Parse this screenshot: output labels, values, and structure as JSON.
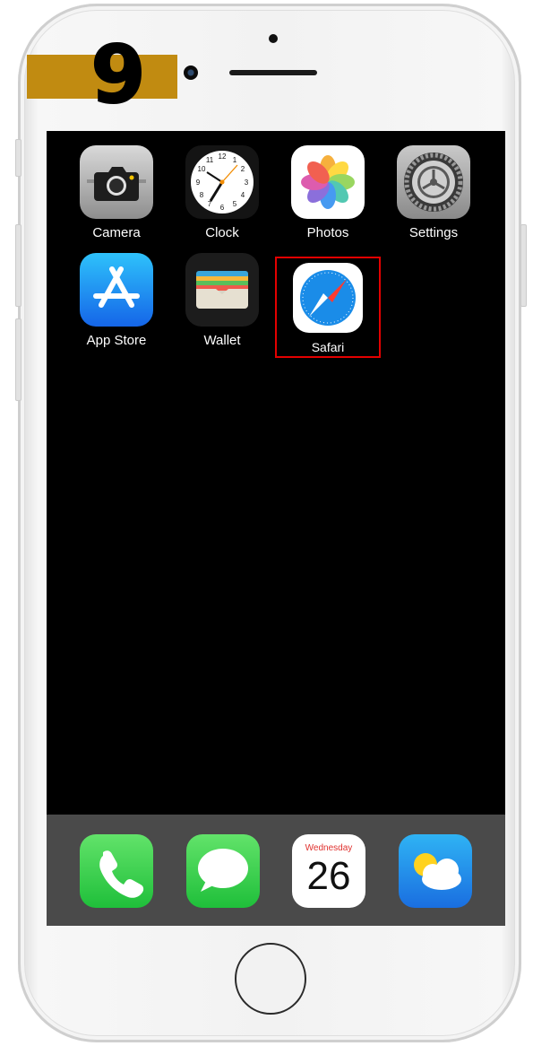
{
  "step": {
    "number": "9",
    "badge_color": "#c18b11"
  },
  "home_apps": [
    {
      "label": "Camera",
      "icon": "camera-icon"
    },
    {
      "label": "Clock",
      "icon": "clock-icon"
    },
    {
      "label": "Photos",
      "icon": "photos-icon"
    },
    {
      "label": "Settings",
      "icon": "settings-gear-icon"
    },
    {
      "label": "App Store",
      "icon": "app-store-icon"
    },
    {
      "label": "Wallet",
      "icon": "wallet-icon"
    },
    {
      "label": "Safari",
      "icon": "safari-compass-icon"
    }
  ],
  "dock": {
    "apps": [
      {
        "name": "Phone",
        "icon": "phone-icon"
      },
      {
        "name": "Messages",
        "icon": "messages-icon"
      },
      {
        "name": "Calendar",
        "icon": "calendar-icon",
        "day": "Wednesday",
        "date": "26"
      },
      {
        "name": "Weather",
        "icon": "weather-icon"
      }
    ]
  },
  "highlight": {
    "target": "Safari",
    "color": "#e30000"
  }
}
